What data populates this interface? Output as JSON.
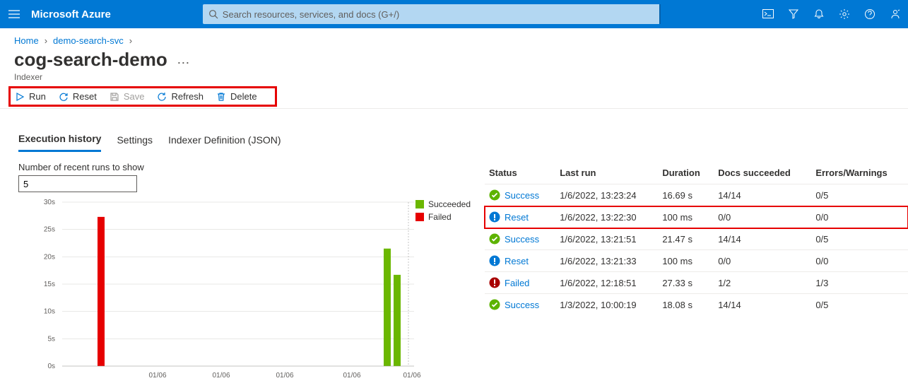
{
  "brand": "Microsoft Azure",
  "search": {
    "placeholder": "Search resources, services, and docs (G+/)"
  },
  "breadcrumb": {
    "home": "Home",
    "parent": "demo-search-svc"
  },
  "page": {
    "title": "cog-search-demo",
    "subtitle": "Indexer"
  },
  "commands": {
    "run": "Run",
    "reset": "Reset",
    "save": "Save",
    "refresh": "Refresh",
    "delete": "Delete"
  },
  "tabs": {
    "history": "Execution history",
    "settings": "Settings",
    "json": "Indexer Definition (JSON)"
  },
  "runsField": {
    "label": "Number of recent runs to show",
    "value": "5"
  },
  "legend": {
    "succeeded": "Succeeded",
    "failed": "Failed"
  },
  "table": {
    "headers": {
      "status": "Status",
      "lastrun": "Last run",
      "duration": "Duration",
      "docs": "Docs succeeded",
      "errors": "Errors/Warnings"
    },
    "rows": [
      {
        "kind": "success",
        "status": "Success",
        "lastrun": "1/6/2022, 13:23:24",
        "duration": "16.69 s",
        "docs": "14/14",
        "errors": "0/5"
      },
      {
        "kind": "reset",
        "status": "Reset",
        "lastrun": "1/6/2022, 13:22:30",
        "duration": "100 ms",
        "docs": "0/0",
        "errors": "0/0",
        "highlight": true
      },
      {
        "kind": "success",
        "status": "Success",
        "lastrun": "1/6/2022, 13:21:51",
        "duration": "21.47 s",
        "docs": "14/14",
        "errors": "0/5"
      },
      {
        "kind": "reset",
        "status": "Reset",
        "lastrun": "1/6/2022, 13:21:33",
        "duration": "100 ms",
        "docs": "0/0",
        "errors": "0/0"
      },
      {
        "kind": "failed",
        "status": "Failed",
        "lastrun": "1/6/2022, 12:18:51",
        "duration": "27.33 s",
        "docs": "1/2",
        "errors": "1/3"
      },
      {
        "kind": "success",
        "status": "Success",
        "lastrun": "1/3/2022, 10:00:19",
        "duration": "18.08 s",
        "docs": "14/14",
        "errors": "0/5"
      }
    ]
  },
  "chart_data": {
    "type": "bar",
    "ylabel": "",
    "ylim": [
      0,
      30
    ],
    "yticks": [
      "0s",
      "5s",
      "10s",
      "15s",
      "20s",
      "25s",
      "30s"
    ],
    "categories": [
      "01/06",
      "01/06",
      "01/06",
      "01/06",
      "01/06"
    ],
    "series": [
      {
        "name": "Failed",
        "color": "#e60000",
        "values": [
          27.3,
          null,
          null,
          null,
          null
        ]
      },
      {
        "name": "Succeeded",
        "color": "#6bb700",
        "values": [
          null,
          null,
          null,
          21.5,
          16.7
        ]
      }
    ]
  }
}
